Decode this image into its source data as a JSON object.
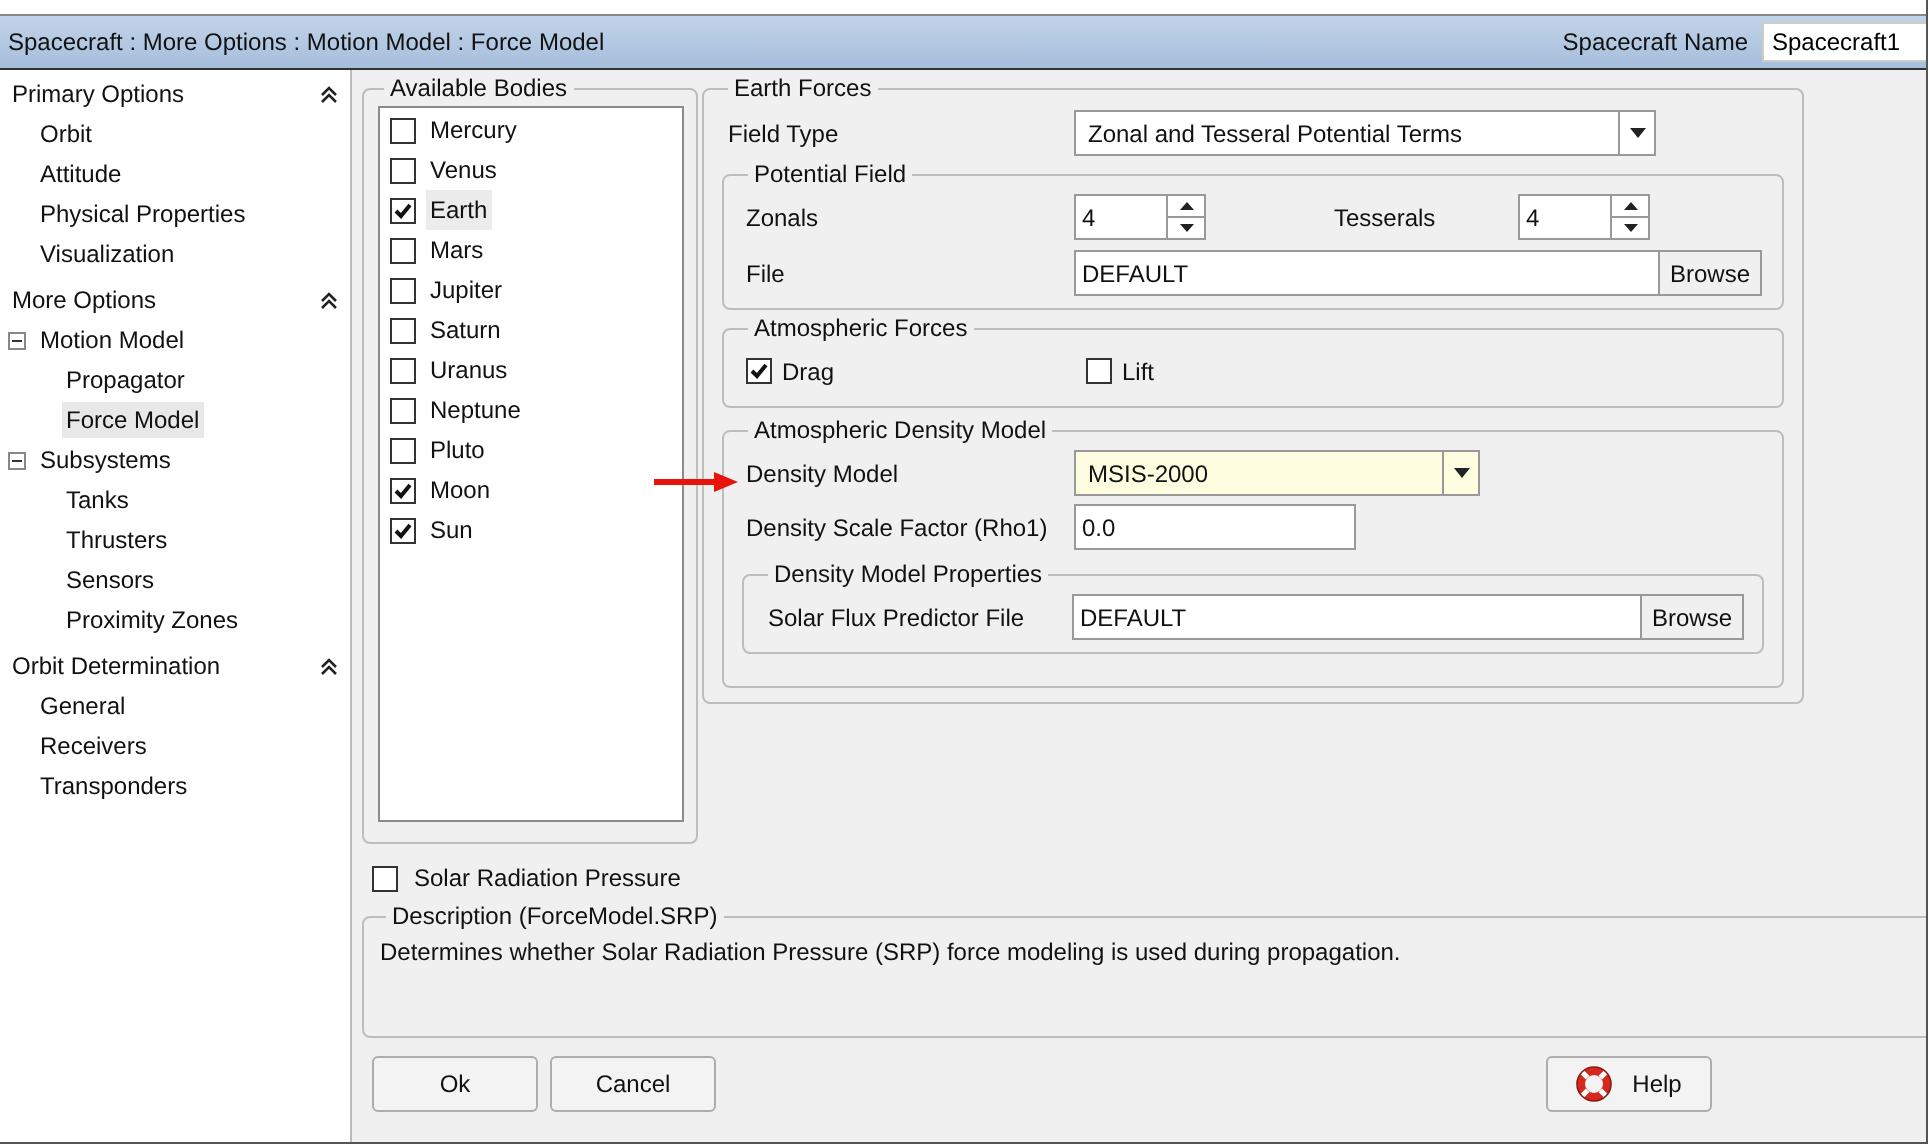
{
  "window": {
    "title": "Spacecraft : More Options : Motion Model : Force Model",
    "name_label": "Spacecraft Name",
    "name_value": "Spacecraft1"
  },
  "sidebar": {
    "sections": [
      {
        "title": "Primary Options",
        "expanded": true,
        "items": [
          {
            "label": "Orbit",
            "selected": false
          },
          {
            "label": "Attitude",
            "selected": false
          },
          {
            "label": "Physical Properties",
            "selected": false
          },
          {
            "label": "Visualization",
            "selected": false
          }
        ]
      },
      {
        "title": "More Options",
        "expanded": true,
        "items": [
          {
            "label": "Motion Model",
            "selected": false,
            "expanded": true,
            "children": [
              {
                "label": "Propagator",
                "selected": false
              },
              {
                "label": "Force Model",
                "selected": true
              }
            ]
          },
          {
            "label": "Subsystems",
            "selected": false,
            "expanded": true,
            "children": [
              {
                "label": "Tanks",
                "selected": false
              },
              {
                "label": "Thrusters",
                "selected": false
              },
              {
                "label": "Sensors",
                "selected": false
              },
              {
                "label": "Proximity Zones",
                "selected": false
              }
            ]
          }
        ]
      },
      {
        "title": "Orbit Determination",
        "expanded": true,
        "items": [
          {
            "label": "General",
            "selected": false
          },
          {
            "label": "Receivers",
            "selected": false
          },
          {
            "label": "Transponders",
            "selected": false
          }
        ]
      }
    ]
  },
  "available_bodies": {
    "title": "Available Bodies",
    "bodies": [
      {
        "name": "Mercury",
        "checked": false,
        "selected": false
      },
      {
        "name": "Venus",
        "checked": false,
        "selected": false
      },
      {
        "name": "Earth",
        "checked": true,
        "selected": true
      },
      {
        "name": "Mars",
        "checked": false,
        "selected": false
      },
      {
        "name": "Jupiter",
        "checked": false,
        "selected": false
      },
      {
        "name": "Saturn",
        "checked": false,
        "selected": false
      },
      {
        "name": "Uranus",
        "checked": false,
        "selected": false
      },
      {
        "name": "Neptune",
        "checked": false,
        "selected": false
      },
      {
        "name": "Pluto",
        "checked": false,
        "selected": false
      },
      {
        "name": "Moon",
        "checked": true,
        "selected": false
      },
      {
        "name": "Sun",
        "checked": true,
        "selected": false
      }
    ]
  },
  "earth_forces": {
    "title": "Earth Forces",
    "field_type_label": "Field Type",
    "field_type": "Zonal and Tesseral Potential Terms",
    "potential_field": {
      "title": "Potential Field",
      "zonals_label": "Zonals",
      "zonals": "4",
      "tesserals_label": "Tesserals",
      "tesserals": "4",
      "file_label": "File",
      "file": "DEFAULT",
      "browse": "Browse"
    },
    "atmospheric_forces": {
      "title": "Atmospheric Forces",
      "options": [
        {
          "label": "Drag",
          "checked": true
        },
        {
          "label": "Lift",
          "checked": false
        }
      ]
    },
    "density": {
      "title": "Atmospheric Density Model",
      "model_label": "Density Model",
      "model": "MSIS-2000",
      "highlighted": true,
      "scale_label": "Density Scale Factor (Rho1)",
      "scale": "0.0",
      "properties": {
        "title": "Density Model Properties",
        "flux_label": "Solar Flux Predictor File",
        "flux_file": "DEFAULT",
        "browse": "Browse"
      }
    }
  },
  "srp": {
    "label": "Solar Radiation Pressure",
    "checked": false
  },
  "description": {
    "title": "Description (ForceModel.SRP)",
    "text": "Determines whether Solar Radiation Pressure (SRP) force modeling is used during propagation."
  },
  "buttons": [
    {
      "label": "Ok"
    },
    {
      "label": "Cancel"
    }
  ],
  "help_button": {
    "label": "Help"
  }
}
